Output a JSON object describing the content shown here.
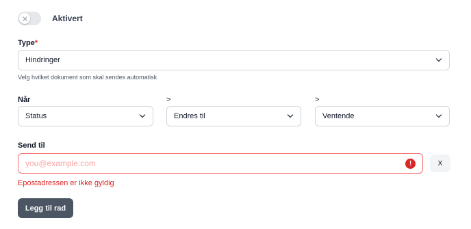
{
  "toggle": {
    "label": "Aktivert",
    "on": false
  },
  "type_field": {
    "label": "Type",
    "required_mark": "*",
    "value": "Hindringer",
    "hint": "Velg hvilket dokument som skal sendes automatisk"
  },
  "condition": {
    "when_label": "Når",
    "sep1": ">",
    "sep2": ">",
    "field_value": "Status",
    "operator_value": "Endres til",
    "target_value": "Ventende"
  },
  "send_to": {
    "label": "Send til",
    "placeholder": "you@example.com",
    "value": "",
    "error_icon": "!",
    "remove_label": "X",
    "error": "Epostadressen er ikke gyldig"
  },
  "add_row_label": "Legg til rad",
  "colors": {
    "error": "#dc2626",
    "button": "#4b5563",
    "border": "#d1d5db"
  }
}
